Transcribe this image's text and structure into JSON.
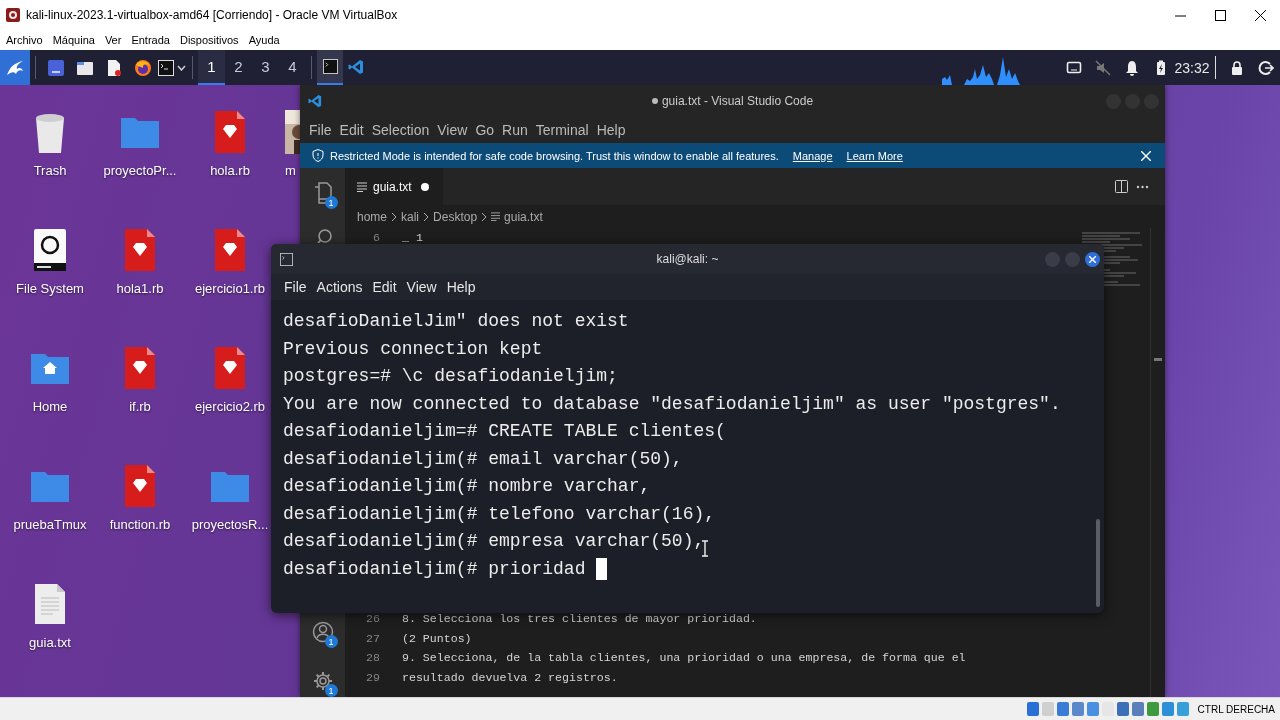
{
  "host_window": {
    "title": "kali-linux-2023.1-virtualbox-amd64 [Corriendo] - Oracle VM VirtualBox",
    "menu": [
      "Archivo",
      "Máquina",
      "Ver",
      "Entrada",
      "Dispositivos",
      "Ayuda"
    ],
    "status_text": "CTRL DERECHA"
  },
  "panel": {
    "workspaces": [
      {
        "label": "1",
        "selected": true
      },
      {
        "label": "2",
        "selected": false
      },
      {
        "label": "3",
        "selected": false
      },
      {
        "label": "4",
        "selected": false
      }
    ],
    "tasks": [
      {
        "kind": "terminal",
        "selected": true
      },
      {
        "kind": "code",
        "selected": false
      }
    ],
    "clock": "23:32"
  },
  "desktop": {
    "columns": [
      {
        "icons": [
          {
            "label": "Trash",
            "kind": "trash"
          },
          {
            "label": "File System",
            "kind": "drive"
          },
          {
            "label": "Home",
            "kind": "home"
          },
          {
            "label": "pruebaTmux",
            "kind": "folder"
          },
          {
            "label": "guia.txt",
            "kind": "text"
          }
        ]
      },
      {
        "icons": [
          {
            "label": "proyectoPr...",
            "kind": "folder"
          },
          {
            "label": "hola1.rb",
            "kind": "ruby"
          },
          {
            "label": "if.rb",
            "kind": "ruby"
          },
          {
            "label": "function.rb",
            "kind": "ruby"
          }
        ]
      },
      {
        "icons": [
          {
            "label": "hola.rb",
            "kind": "ruby"
          },
          {
            "label": "ejercicio1.rb",
            "kind": "ruby"
          },
          {
            "label": "ejercicio2.rb",
            "kind": "ruby"
          },
          {
            "label": "proyectosR...",
            "kind": "folder"
          }
        ]
      },
      {
        "icons": [
          {
            "label": "m",
            "kind": "picture"
          }
        ]
      }
    ]
  },
  "vscode": {
    "title": "guia.txt - Visual Studio Code",
    "modified": true,
    "menu": [
      "File",
      "Edit",
      "Selection",
      "View",
      "Go",
      "Run",
      "Terminal",
      "Help"
    ],
    "banner": {
      "text": "Restricted Mode is intended for safe code browsing. Trust this window to enable all features.",
      "links": [
        "Manage",
        "Learn More"
      ]
    },
    "tab": {
      "label": "guia.txt",
      "modified": true
    },
    "breadcrumbs": [
      "home",
      "kali",
      "Desktop",
      "guia.txt"
    ],
    "activity": [
      {
        "kind": "explorer",
        "badge": "1"
      },
      {
        "kind": "search"
      },
      {
        "kind": "account",
        "badge": "1"
      },
      {
        "kind": "settings",
        "badge": "1"
      }
    ],
    "lines_top": [
      {
        "number": "6",
        "text": "_ 1"
      }
    ],
    "lines_bottom": [
      {
        "number": "26",
        "text": "8. Selecciona los tres clientes de mayor prioridad."
      },
      {
        "number": "27",
        "text": "(2 Puntos)"
      },
      {
        "number": "28",
        "text": "9. Selecciona, de la tabla clientes, una prioridad o una empresa, de forma que el"
      },
      {
        "number": "29",
        "text": "resultado devuelva 2 registros."
      }
    ]
  },
  "terminal": {
    "title": "kali@kali: ~",
    "menu": [
      "File",
      "Actions",
      "Edit",
      "View",
      "Help"
    ],
    "lines": [
      "desafioDanielJim\" does not exist",
      "Previous connection kept",
      "postgres=# \\c desafiodanieljim;",
      "You are now connected to database \"desafiodanieljim\" as user \"postgres\".",
      "desafiodanieljim=# CREATE TABLE clientes(",
      "desafiodanieljim(# email varchar(50),",
      "desafiodanieljim(# nombre varchar,",
      "desafiodanieljim(# telefono varchar(16),",
      "desafiodanieljim(# empresa varchar(50),",
      "desafiodanieljim(# prioridad "
    ],
    "cursor": true
  }
}
